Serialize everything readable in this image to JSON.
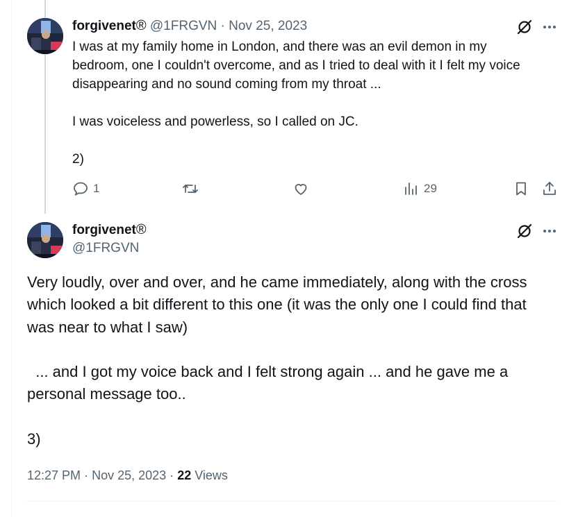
{
  "tweet1": {
    "display_name": "forgivenet",
    "reg_mark": "®",
    "handle": "@1FRGVN",
    "separator": "·",
    "date": "Nov 25, 2023",
    "text": "I was at my family home in London, and there was an evil demon in my bedroom, one I couldn't overcome, and as I tried to deal with it I felt my voice disappearing and no sound coming from my throat ...\n\nI was voiceless and powerless, so I called on JC.\n\n2)",
    "actions": {
      "reply_count": "1",
      "views_count": "29"
    }
  },
  "tweet2": {
    "display_name": "forgivenet",
    "reg_mark": "®",
    "handle": "@1FRGVN",
    "text": "Very loudly, over and over, and he came immediately, along with the cross which looked a bit different to this one (it was the only one I could find that was near to what I saw)\n\n  ... and I got my voice back and I felt strong again ... and he gave me a personal message too..\n\n3)",
    "time": "12:27 PM",
    "separator": "·",
    "date": "Nov 25, 2023",
    "views_count": "22",
    "views_label": "Views"
  },
  "icons": {
    "grok": "grok-icon",
    "more": "more-icon",
    "reply": "reply-icon",
    "retweet": "retweet-icon",
    "like": "like-icon",
    "views": "views-icon",
    "bookmark": "bookmark-icon",
    "share": "share-icon"
  },
  "colors": {
    "text": "#0f1419",
    "muted": "#536471",
    "thread_line": "#cfd9de",
    "border": "#eff3f4"
  }
}
